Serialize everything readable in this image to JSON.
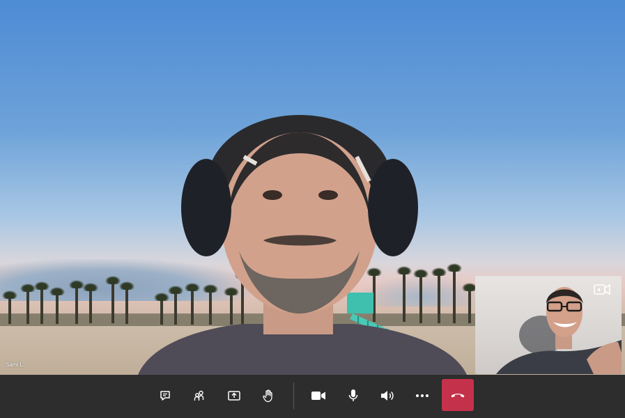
{
  "participant": {
    "name": "Sami L."
  },
  "toolbar": {
    "buttons": [
      {
        "name": "chat",
        "icon": "chat-icon"
      },
      {
        "name": "participants",
        "icon": "people-icon"
      },
      {
        "name": "share",
        "icon": "share-screen-icon"
      },
      {
        "name": "raise-hand",
        "icon": "raise-hand-icon"
      },
      {
        "name": "camera",
        "icon": "video-camera-icon"
      },
      {
        "name": "microphone",
        "icon": "microphone-icon"
      },
      {
        "name": "speaker",
        "icon": "speaker-icon"
      },
      {
        "name": "more",
        "icon": "more-dots-icon"
      }
    ],
    "hangup_icon": "hang-up-icon"
  },
  "colors": {
    "hangup": "#c4314b",
    "toolbar_bg": "#2d2d2d",
    "icon": "#ffffff"
  }
}
